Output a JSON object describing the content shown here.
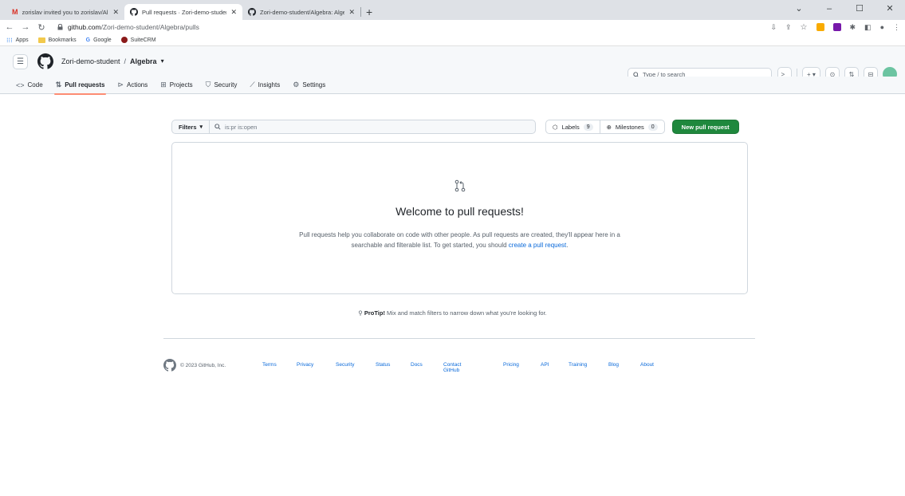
{
  "browser": {
    "tabs": [
      {
        "title": "zorislav invited you to zorislav/Al",
        "icon": "gmail-icon"
      },
      {
        "title": "Pull requests · Zori-demo-studen",
        "icon": "github-icon"
      },
      {
        "title": "Zori-demo-student/Algebra: Alge",
        "icon": "github-icon"
      }
    ],
    "url_domain": "github.com",
    "url_path": "/Zori-demo-student/Algebra/pulls",
    "bookmarks": [
      "Apps",
      "Bookmarks",
      "Google",
      "SuiteCRM"
    ]
  },
  "header": {
    "owner": "Zori-demo-student",
    "separator": "/",
    "repo": "Algebra",
    "search_placeholder": "Type / to search",
    "search_key": "/"
  },
  "repo_nav": [
    {
      "label": "Code",
      "icon": "code-icon"
    },
    {
      "label": "Pull requests",
      "icon": "pull-request-icon",
      "selected": true
    },
    {
      "label": "Actions",
      "icon": "play-icon"
    },
    {
      "label": "Projects",
      "icon": "table-icon"
    },
    {
      "label": "Security",
      "icon": "shield-icon"
    },
    {
      "label": "Insights",
      "icon": "graph-icon"
    },
    {
      "label": "Settings",
      "icon": "gear-icon"
    }
  ],
  "subnav": {
    "filters_label": "Filters",
    "query": "is:pr is:open",
    "labels_label": "Labels",
    "labels_count": "9",
    "milestones_label": "Milestones",
    "milestones_count": "0",
    "new_pr_label": "New pull request"
  },
  "blankslate": {
    "title": "Welcome to pull requests!",
    "text_before": "Pull requests help you collaborate on code with other people. As pull requests are created, they'll appear here in a searchable and filterable list. To get started, you should ",
    "link": "create a pull request",
    "text_after": "."
  },
  "protip": {
    "label": "ProTip!",
    "text": " Mix and match filters to narrow down what you're looking for."
  },
  "footer": {
    "copyright": "© 2023 GitHub, Inc.",
    "links": [
      "Terms",
      "Privacy",
      "Security",
      "Status",
      "Docs",
      "Contact GitHub",
      "Pricing",
      "API",
      "Training",
      "Blog",
      "About"
    ]
  },
  "colors": {
    "primary_button": "#1f883d",
    "link": "#0969da",
    "selected_tab_underline": "#fd8c73"
  }
}
